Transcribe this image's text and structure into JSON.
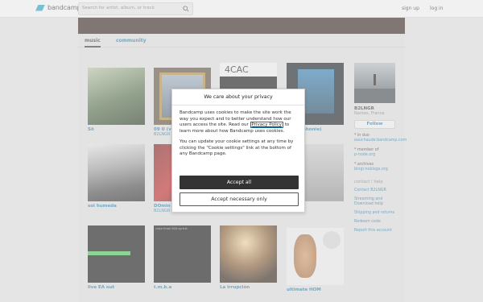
{
  "header": {
    "logo_text": "bandcamp",
    "search_placeholder": "Search for artist, album, or track",
    "signup": "sign up",
    "login": "log in"
  },
  "tabs": {
    "music": "music",
    "community": "community"
  },
  "albums": [
    {
      "title": "Sō",
      "artist": ""
    },
    {
      "title": "09 II (v",
      "artist": "B2LNGR"
    },
    {
      "title": "",
      "artist": ""
    },
    {
      "title": "(microphonie)",
      "artist": ""
    },
    {
      "title": "sol humeda",
      "artist": ""
    },
    {
      "title": "DOmin",
      "artist": "B2LNGR"
    },
    {
      "title": "",
      "artist": ""
    },
    {
      "title": "ntains",
      "artist": ""
    },
    {
      "title": "live EA out",
      "artist": ""
    },
    {
      "title": "t.m.b.a",
      "artist": ""
    },
    {
      "title": "La irrupción",
      "artist": ""
    },
    {
      "title": "ultimate HOM",
      "artist": ""
    }
  ],
  "album_art_text": {
    "c3": "4CAC",
    "c10": "close thrall B2lt syrtrst"
  },
  "sidebar": {
    "band_name": "B2LNGR",
    "location": "Nantes, France",
    "follow": "Follow",
    "item1": "* in duo",
    "item1_link": "eauchaude.bandcamp.com",
    "item2": "* member of",
    "item2_link": "p-node.org",
    "item3": "* archives",
    "item3_link": "blngr.noblogs.org",
    "contact_label": "contact / help",
    "links": [
      "Contact B2LNGR",
      "Streaming and Download help",
      "Shipping and returns",
      "Redeem code",
      "Report this account"
    ]
  },
  "cookie": {
    "title": "We care about your privacy",
    "para1_before": "Bandcamp uses cookies to make the site work the way you expect and to better understand how our users access the site. Read our ",
    "privacy_link": "Privacy Policy",
    "para1_after": " to learn more about how Bandcamp uses cookies.",
    "para2": "You can update your cookie settings at any time by clicking the \"Cookie settings\" link at the bottom of any Bandcamp page.",
    "accept_all": "Accept all",
    "accept_necessary": "Accept necessary only"
  }
}
